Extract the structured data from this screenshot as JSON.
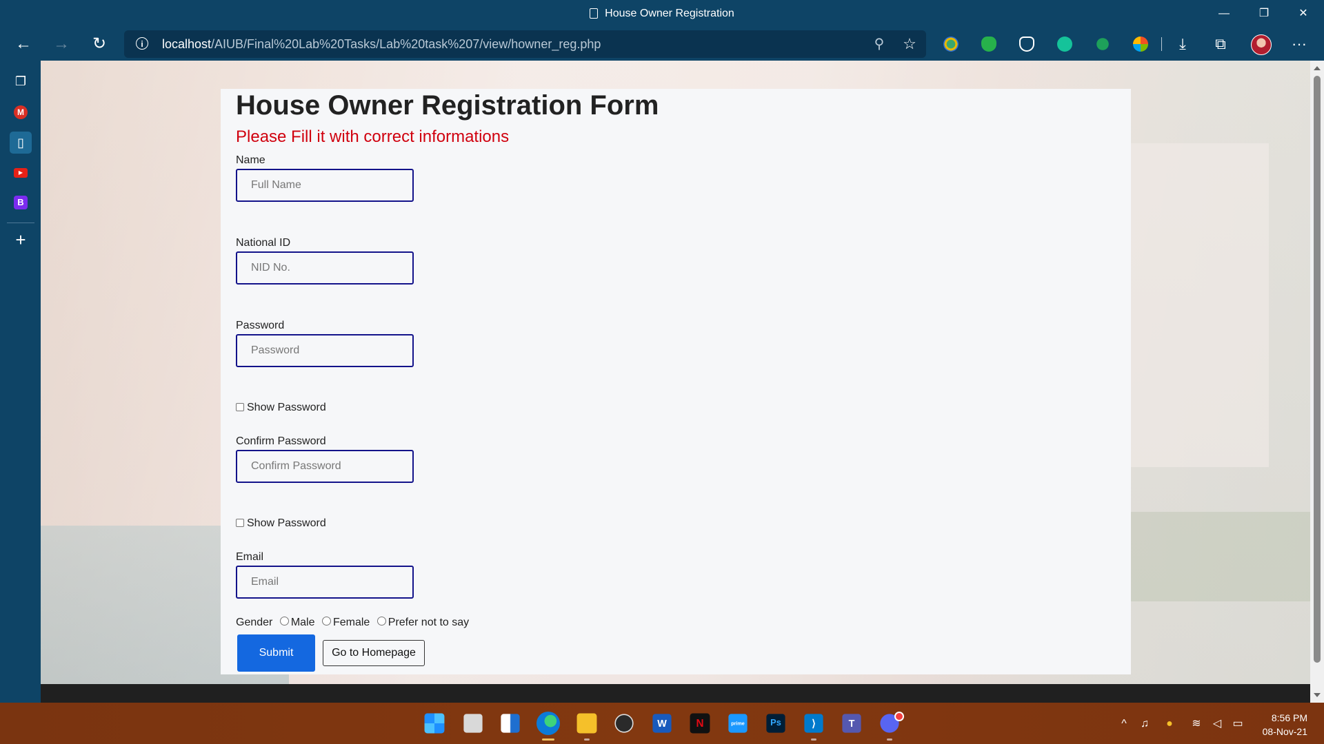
{
  "window": {
    "title": "House Owner Registration",
    "minimize_glyph": "—",
    "restore_glyph": "❐",
    "close_glyph": "✕"
  },
  "toolbar": {
    "back_glyph": "←",
    "forward_glyph": "→",
    "refresh_glyph": "↻",
    "url_host": "localhost",
    "url_path": "/AIUB/Final%20Lab%20Tasks/Lab%20task%207/view/howner_reg.php",
    "zoom_glyph": "⚲",
    "favorite_glyph": "☆",
    "menu_glyph": "···"
  },
  "sidebar": {
    "items": [
      {
        "icon": "tabs-icon",
        "glyph": "❐"
      },
      {
        "icon": "gmail-icon",
        "glyph": "M"
      },
      {
        "icon": "document-icon",
        "glyph": "▯"
      },
      {
        "icon": "youtube-icon",
        "glyph": "▶"
      },
      {
        "icon": "bootstrap-icon",
        "glyph": "B"
      }
    ],
    "add_glyph": "+"
  },
  "form": {
    "title": "House Owner Registration Form",
    "subtitle": "Please Fill it with correct informations",
    "name_label": "Name",
    "name_placeholder": "Full Name",
    "nid_label": "National ID",
    "nid_placeholder": "NID No.",
    "password_label": "Password",
    "password_placeholder": "Password",
    "show_password_label": "Show Password",
    "confirm_label": "Confirm Password",
    "confirm_placeholder": "Confirm Password",
    "show_password_label_2": "Show Password",
    "email_label": "Email",
    "email_placeholder": "Email",
    "gender_label": "Gender",
    "gender_options": [
      "Male",
      "Female",
      "Prefer not to say"
    ],
    "submit_label": "Submit",
    "homepage_label": "Go to Homepage"
  },
  "taskbar": {
    "clock_time": "8:56 PM",
    "clock_date": "08-Nov-21",
    "tray_up_glyph": "^"
  },
  "colors": {
    "accent": "#1468e0",
    "subtitle_red": "#d0000e",
    "input_border": "#12128a",
    "browser_chrome": "#0e4466"
  }
}
